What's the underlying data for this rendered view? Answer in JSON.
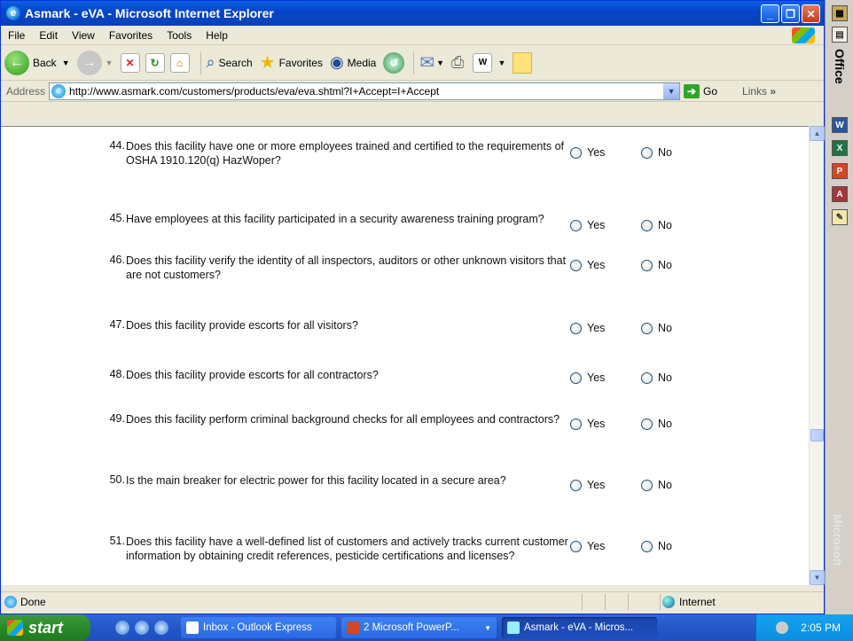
{
  "window": {
    "title": "Asmark - eVA - Microsoft Internet Explorer"
  },
  "menu": [
    "File",
    "Edit",
    "View",
    "Favorites",
    "Tools",
    "Help"
  ],
  "toolbar": {
    "back": "Back",
    "search": "Search",
    "favorites": "Favorites",
    "media": "Media"
  },
  "address": {
    "label": "Address",
    "url": "http://www.asmark.com/customers/products/eva/eva.shtml?I+Accept=I+Accept",
    "go": "Go",
    "links": "Links"
  },
  "answers": {
    "yes": "Yes",
    "no": "No"
  },
  "questions": [
    {
      "num": "44.",
      "text": "Does this facility have one or more employees trained and certified to the requirements of OSHA 1910.120(q) HazWoper?"
    },
    {
      "num": "45.",
      "text": "Have employees at this facility participated in a security awareness training program?"
    },
    {
      "num": "46.",
      "text": "Does this facility verify the identity of all inspectors, auditors or other unknown visitors that are not customers?"
    },
    {
      "num": "47.",
      "text": "Does this facility provide escorts for all visitors?"
    },
    {
      "num": "48.",
      "text": "Does this facility provide escorts for all contractors?"
    },
    {
      "num": "49.",
      "text": "Does this facility perform criminal background checks for all employees and contractors?"
    },
    {
      "num": "50.",
      "text": "Is the main breaker for electric power for this facility located in a secure area?"
    },
    {
      "num": "51.",
      "text": "Does this facility have a well-defined list of customers and actively tracks current customer information by obtaining credit references, pesticide certifications and licenses?"
    }
  ],
  "status": {
    "text": "Done",
    "zone": "Internet"
  },
  "officebar": {
    "title": "Office",
    "brand": "Microsoft"
  },
  "taskbar": {
    "start": "start",
    "tasks": [
      "Inbox - Outlook Express",
      "2 Microsoft PowerP...",
      "Asmark - eVA - Micros..."
    ],
    "clock": "2:05 PM"
  }
}
